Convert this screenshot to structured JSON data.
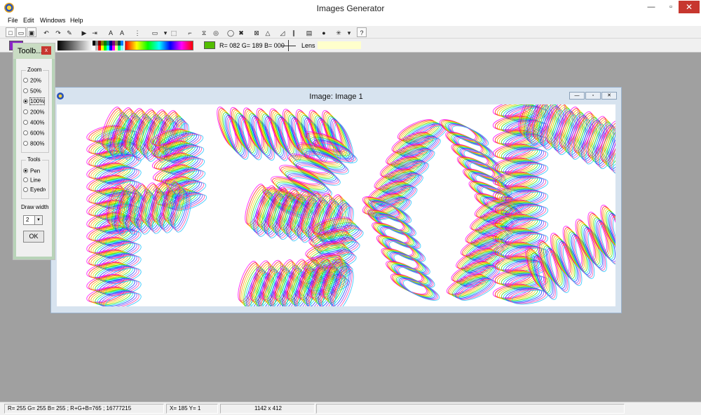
{
  "window": {
    "title": "Images Generator",
    "minimize": "—",
    "maximize": "▫",
    "close": "✕"
  },
  "menu": [
    "File",
    "Edit",
    "Windows",
    "Help"
  ],
  "toolbar": {
    "buttons": [
      {
        "name": "new-file-icon",
        "glyph": "□"
      },
      {
        "name": "open-folder-icon",
        "glyph": "▭"
      },
      {
        "name": "save-icon",
        "glyph": "▣"
      },
      {
        "name": "undo-icon",
        "glyph": "↶"
      },
      {
        "name": "redo-icon",
        "glyph": "↷"
      },
      {
        "name": "pencil-icon",
        "glyph": "✎"
      },
      {
        "name": "play-icon",
        "glyph": "▶"
      },
      {
        "name": "run-step-icon",
        "glyph": "⇥"
      },
      {
        "name": "text-a-icon",
        "glyph": "A"
      },
      {
        "name": "text-b-icon",
        "glyph": "A"
      },
      {
        "name": "grid-icon",
        "glyph": "⋮"
      },
      {
        "name": "dash-icon",
        "glyph": "▭"
      },
      {
        "name": "dropdown-icon",
        "glyph": "▾"
      },
      {
        "name": "selection-icon",
        "glyph": "⬚"
      },
      {
        "name": "crop-icon",
        "glyph": "⌐"
      },
      {
        "name": "sandglass-icon",
        "glyph": "⧖"
      },
      {
        "name": "spiral-icon",
        "glyph": "◎"
      },
      {
        "name": "circle-icon",
        "glyph": "◯"
      },
      {
        "name": "tools-icon",
        "glyph": "✖"
      },
      {
        "name": "pattern-icon",
        "glyph": "⊠"
      },
      {
        "name": "triangle-icon",
        "glyph": "△"
      },
      {
        "name": "ruler-icon",
        "glyph": "◿"
      },
      {
        "name": "lines-icon",
        "glyph": "∥"
      },
      {
        "name": "frame-icon",
        "glyph": "▤"
      },
      {
        "name": "sphere-icon",
        "glyph": "●"
      },
      {
        "name": "star-icon",
        "glyph": "✳"
      },
      {
        "name": "dropdown-2-icon",
        "glyph": "▾"
      },
      {
        "name": "rotate-icon",
        "glyph": "↻"
      },
      {
        "name": "help-icon",
        "glyph": "?"
      }
    ]
  },
  "colorbar": {
    "current_color": "#8a25c8",
    "basic_colors": [
      "#000000",
      "#808080",
      "#800000",
      "#808000",
      "#008000",
      "#008080",
      "#000080",
      "#800080",
      "#808040",
      "#004040",
      "#0080ff",
      "#ffffff",
      "#c0c0c0",
      "#ff0000",
      "#ffff00",
      "#00ff00",
      "#00ffff",
      "#0000ff",
      "#ff00ff",
      "#ffff80",
      "#00ff80",
      "#80ffff"
    ],
    "selected_color": "#52bd00",
    "rgb_text": "R= 082  G= 189  B= 000",
    "lens_label": "Lens"
  },
  "toolbox": {
    "title": "Toolb...",
    "close": "x",
    "zoom_label": "Zoom",
    "zoom_options": [
      "20%",
      "50%",
      "100%",
      "200%",
      "400%",
      "600%",
      "800%"
    ],
    "zoom_selected": "100%",
    "tools_label": "Tools",
    "tool_options": [
      "Pen",
      "Line",
      "Eyedropper"
    ],
    "tool_selected": "Pen",
    "draw_width_label": "Draw width",
    "draw_width_value": "2",
    "ok_label": "OK"
  },
  "image_window": {
    "title": "Image: Image 1",
    "minimize": "—",
    "maximize": "▫",
    "close": "✕",
    "artwork_text": "P3OD"
  },
  "status": {
    "rgb": "R= 255  G= 255  B= 255  ;   R+G+B=765  ;   16777215",
    "coords": "X= 185   Y= 1",
    "size": "1142 x 412",
    "extra": ""
  }
}
